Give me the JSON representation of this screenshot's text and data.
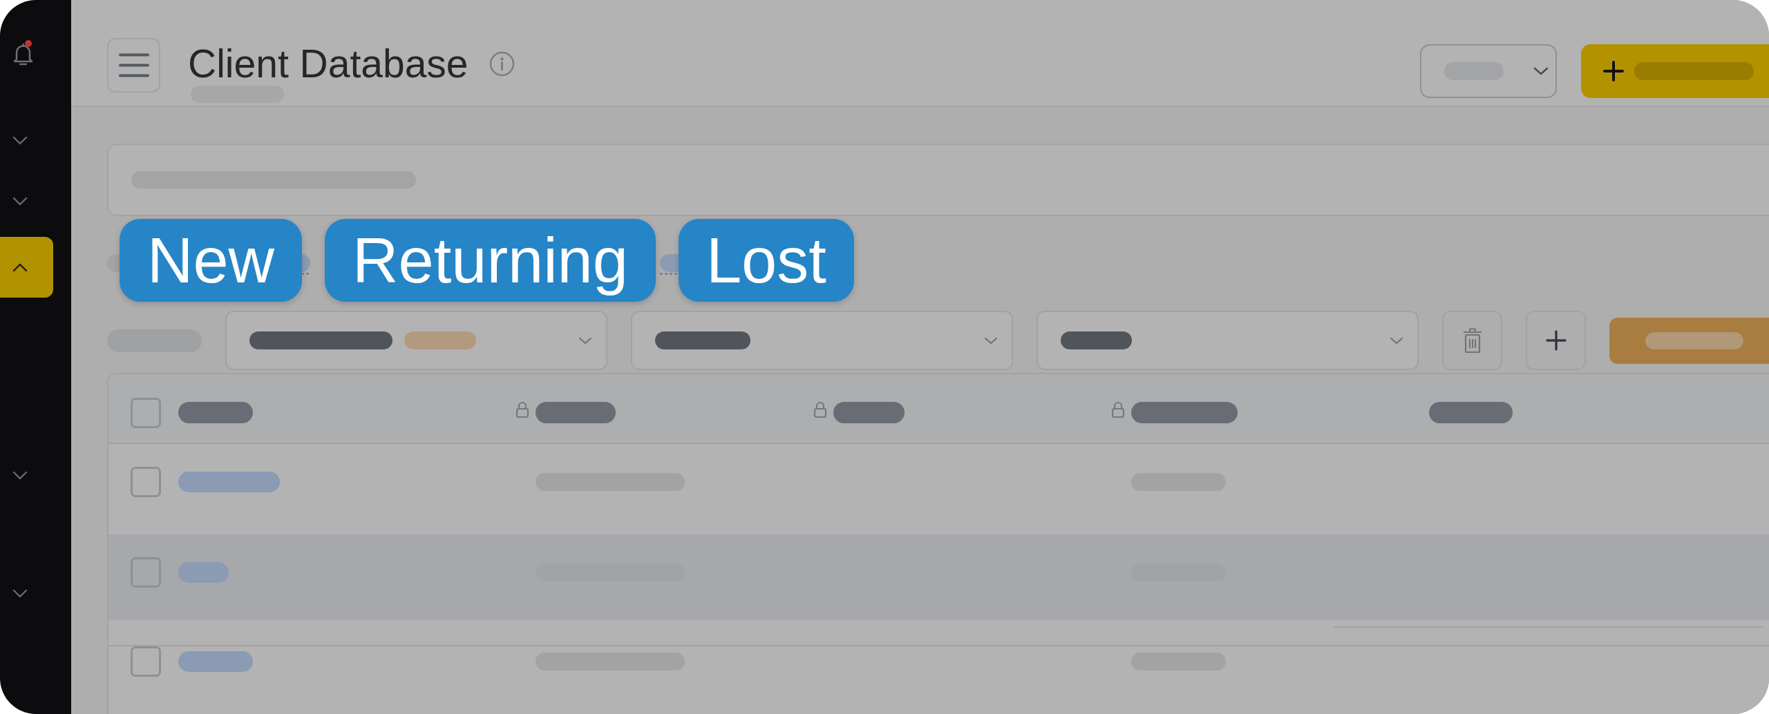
{
  "sidebar": {
    "notifications": {
      "unread": true
    },
    "items": [
      {
        "selected": false,
        "expanded": false
      },
      {
        "selected": false,
        "expanded": false
      },
      {
        "selected": true,
        "expanded": true
      },
      {
        "selected": false,
        "expanded": false
      },
      {
        "selected": false,
        "expanded": false
      }
    ]
  },
  "header": {
    "title": "Client Database"
  },
  "tags": [
    {
      "label": "New"
    },
    {
      "label": "Returning"
    },
    {
      "label": "Lost"
    }
  ],
  "table": {
    "select_all": {
      "checked": false
    },
    "columns": [
      {
        "locked": false
      },
      {
        "locked": true
      },
      {
        "locked": true
      },
      {
        "locked": true
      },
      {
        "locked": false
      }
    ],
    "rows": [
      {
        "checked": false,
        "highlighted": false
      },
      {
        "checked": false,
        "highlighted": true
      },
      {
        "checked": false,
        "highlighted": false
      }
    ]
  }
}
